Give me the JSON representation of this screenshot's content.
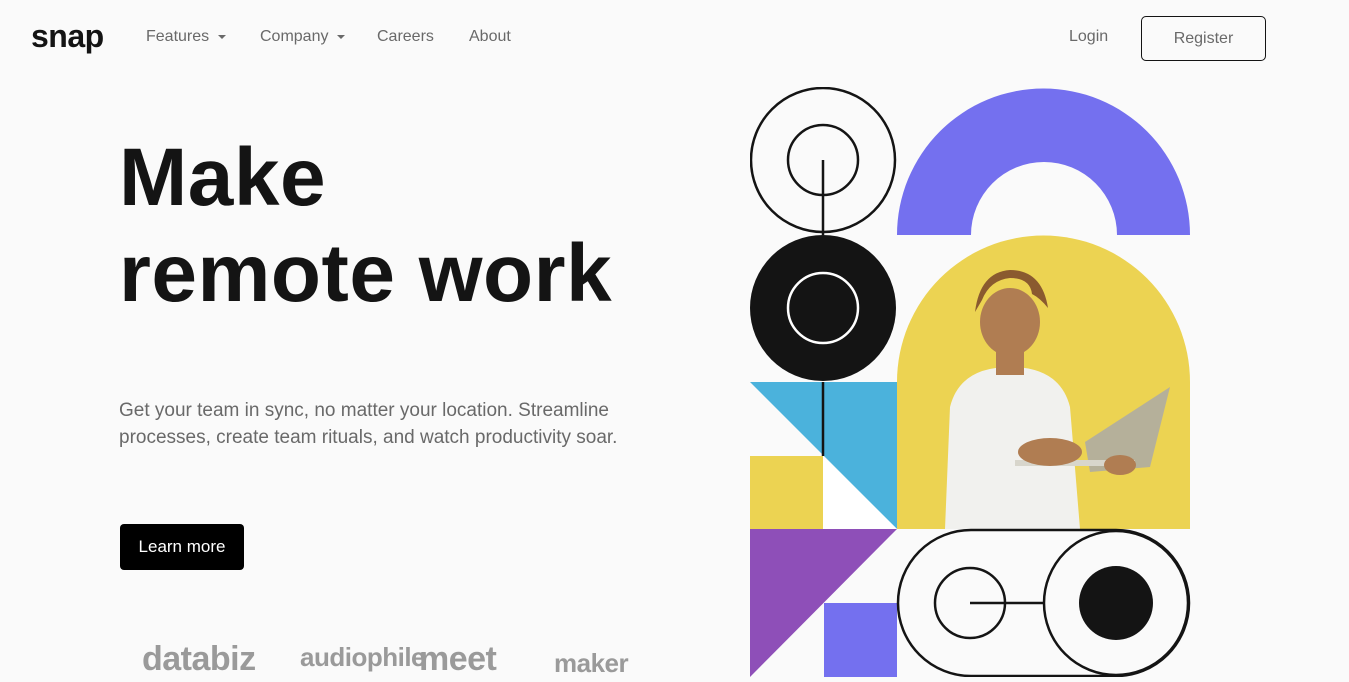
{
  "brand": {
    "logo": "snap"
  },
  "nav": {
    "items": [
      {
        "label": "Features",
        "dropdown": true
      },
      {
        "label": "Company",
        "dropdown": true
      },
      {
        "label": "Careers",
        "dropdown": false
      },
      {
        "label": "About",
        "dropdown": false
      }
    ],
    "login": "Login",
    "register": "Register"
  },
  "hero": {
    "title_line1": "Make",
    "title_line2": "remote work",
    "description": "Get your team in sync, no matter your location. Streamline processes, create team rituals, and watch productivity soar.",
    "cta": "Learn more"
  },
  "clients": [
    "databiz",
    "audiophile",
    "meet",
    "maker"
  ],
  "colors": {
    "purple": "#7470ef",
    "yellow": "#ecd352",
    "blue": "#4bb2dc",
    "violet": "#8e4fb8",
    "dark": "#141414"
  }
}
